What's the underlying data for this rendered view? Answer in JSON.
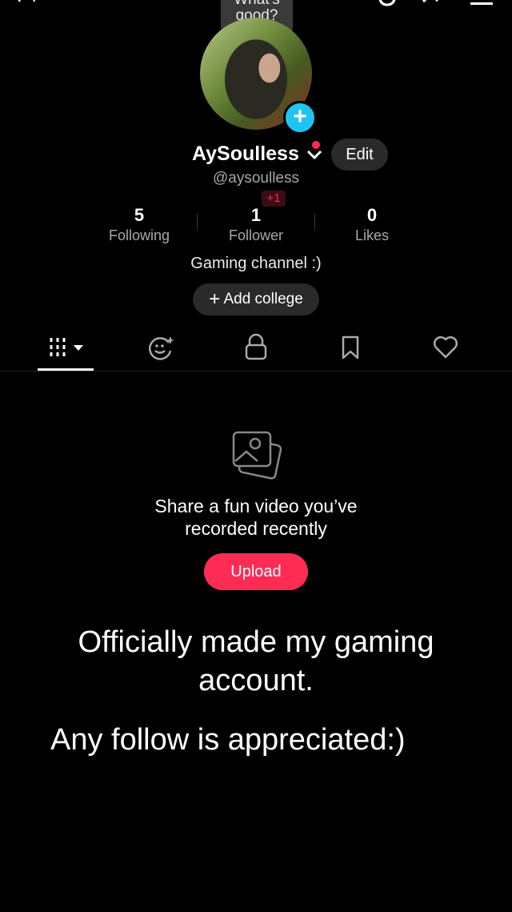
{
  "bubble": {
    "line1": "What's",
    "line2": "good?"
  },
  "profile": {
    "username": "AySoulless",
    "handle": "@aysoulless",
    "edit_label": "Edit",
    "new_followers_badge": "+1",
    "bio": "Gaming channel :)",
    "add_college_label": "Add college"
  },
  "stats": [
    {
      "value": "5",
      "label": "Following"
    },
    {
      "value": "1",
      "label": "Follower"
    },
    {
      "value": "0",
      "label": "Likes"
    }
  ],
  "tabs": [
    {
      "icon": "grid-icon"
    },
    {
      "icon": "ai-self-icon"
    },
    {
      "icon": "lock-icon"
    },
    {
      "icon": "bookmark-icon"
    },
    {
      "icon": "heart-icon"
    }
  ],
  "empty_state": {
    "line1": "Share a fun video you’ve",
    "line2": "recorded recently",
    "upload_label": "Upload"
  },
  "caption": {
    "line1": "Officially made my gaming",
    "line2": "account.",
    "line3": "Any follow is appreciated:)"
  },
  "colors": {
    "accent": "#fe2c55",
    "badge_blue": "#20c4f0",
    "background": "#000000"
  }
}
